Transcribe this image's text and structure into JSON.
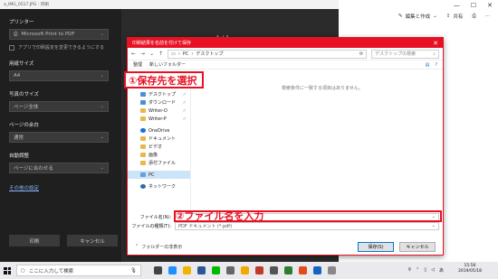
{
  "photos_app": {
    "window_title": "a_IMG_0517.JPG - 印刷",
    "edit_create_label": "編集と作成",
    "share_label": "共有"
  },
  "print_dialog": {
    "printer_label": "プリンター",
    "printer_value": "Microsoft Print to PDF",
    "app_settings_checkbox": "アプリで印刷設定を変更できるようにする",
    "paper_size_label": "用紙サイズ",
    "paper_size_value": "A4",
    "photo_size_label": "写真のサイズ",
    "photo_size_value": "ページ全体",
    "margin_label": "ページの余白",
    "margin_value": "通常",
    "auto_adjust_label": "自動調整",
    "auto_adjust_value": "ページに合わせる",
    "other_settings_link": "その他の設定",
    "print_button": "印刷",
    "cancel_button": "キャンセル",
    "page_indicator": "1 / 1"
  },
  "save_dialog": {
    "title": "印刷結果を名前を付けて保存",
    "breadcrumb": [
      "PC",
      "デスクトップ"
    ],
    "search_placeholder": "デスクトップの検索",
    "organize_label": "整理",
    "new_folder_label": "新しいフォルダー",
    "quick_access_label": "クイック アクセス",
    "nav_items": [
      {
        "label": "デスクトップ",
        "icon": "folder-blue-icon",
        "pinned": true
      },
      {
        "label": "ダウンロード",
        "icon": "download-icon",
        "pinned": true
      },
      {
        "label": "Writer-O",
        "icon": "folder-icon",
        "pinned": true
      },
      {
        "label": "Writer-P",
        "icon": "folder-icon",
        "pinned": true
      }
    ],
    "onedrive_label": "OneDrive",
    "onedrive_items": [
      "ドキュメント",
      "ビデオ",
      "画像",
      "添付ファイル"
    ],
    "pc_label": "PC",
    "network_label": "ネットワーク",
    "empty_message": "検索条件に一致する項目はありません。",
    "filename_label": "ファイル名(N):",
    "filename_value": "",
    "filetype_label": "ファイルの種類(T):",
    "filetype_value": "PDF ドキュメント (*.pdf)",
    "hide_folders_label": "フォルダーの非表示",
    "save_button": "保存(S)",
    "cancel_button": "キャンセル"
  },
  "annotations": {
    "step1": "①保存先を選択",
    "step2": "②ファイル名を入力",
    "color": "#e81123"
  },
  "taskbar": {
    "search_placeholder": "ここに入力して検索",
    "time": "15:56",
    "date": "2019/05/18",
    "ime": "あ"
  }
}
